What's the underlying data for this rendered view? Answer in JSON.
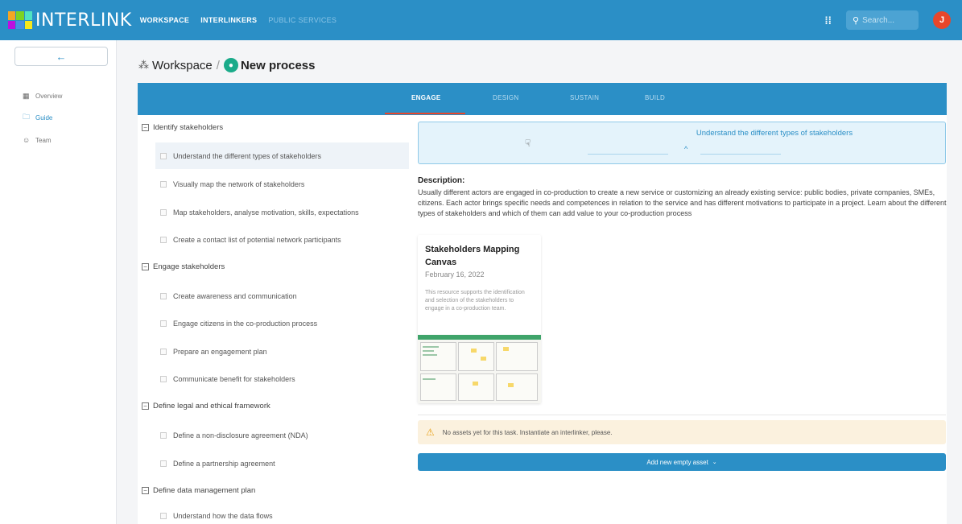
{
  "app": {
    "logo_text": "INTERLINK",
    "nav": [
      {
        "label": "WORKSPACE"
      },
      {
        "label": "INTERLINKERS"
      },
      {
        "label": "PUBLIC SERVICES"
      }
    ],
    "apps_icon": "grid-icon",
    "search_placeholder": "Search...",
    "avatar_initial": "J"
  },
  "sidebar": {
    "back_arrow": "←",
    "items": [
      {
        "label": "Overview",
        "icon": "dashboard-icon"
      },
      {
        "label": "Guide",
        "icon": "folder-icon"
      },
      {
        "label": "Team",
        "icon": "team-icon"
      }
    ]
  },
  "breadcrumb": {
    "workspace": "Workspace",
    "separator": "/",
    "process": "New process"
  },
  "phases": [
    "ENGAGE",
    "DESIGN",
    "SUSTAIN",
    "BUILD"
  ],
  "tree": [
    {
      "label": "Identify stakeholders",
      "items": [
        "Understand the different types of stakeholders",
        "Visually map the network of stakeholders",
        "Map stakeholders, analyse motivation, skills, expectations",
        "Create a contact list of potential network participants"
      ]
    },
    {
      "label": "Engage stakeholders",
      "items": [
        "Create awareness and communication",
        "Engage citizens in the co-production process",
        "Prepare an engagement plan",
        "Communicate benefit for stakeholders"
      ]
    },
    {
      "label": "Define legal and ethical framework",
      "items": [
        "Define a non-disclosure agreement (NDA)",
        "Define a partnership agreement"
      ]
    },
    {
      "label": "Define data management plan",
      "items": [
        "Understand how the data flows"
      ]
    }
  ],
  "task": {
    "title": "Understand the different types of stakeholders",
    "caret": "^",
    "description_label": "Description:",
    "description": "Usually different actors are engaged in co-production to create a new service or customizing an already existing service: public bodies, private companies, SMEs, citizens. Each actor brings specific needs and competences in relation to the service and has different motivations to participate in a project. Learn about the different types of stakeholders and which of them can add value to your co-production process"
  },
  "card": {
    "title": "Stakeholders Mapping Canvas",
    "date": "February 16, 2022",
    "description": "This resource supports the identification and selection of the stakeholders to engage in a co-production team."
  },
  "alert": {
    "icon": "warning-icon",
    "text": "No assets yet for this task. Instantiate an interlinker, please."
  },
  "add_button": {
    "label": "Add new empty asset",
    "chevron": "⌄"
  }
}
